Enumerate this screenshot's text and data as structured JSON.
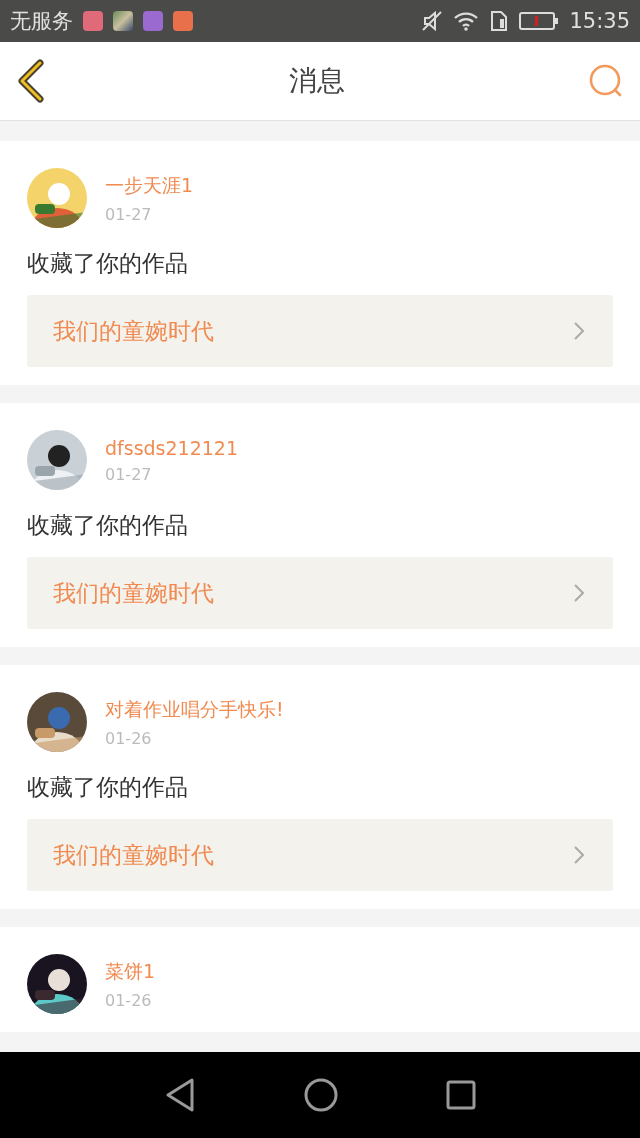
{
  "status_bar": {
    "carrier": "无服务",
    "time": "15:35"
  },
  "header": {
    "title": "消息"
  },
  "messages": [
    {
      "user": "一步天涯1",
      "date": "01-27",
      "action": "收藏了你的作品",
      "work": "我们的童婉时代"
    },
    {
      "user": "dfssds212121",
      "date": "01-27",
      "action": "收藏了你的作品",
      "work": "我们的童婉时代"
    },
    {
      "user": "对着作业唱分手快乐!",
      "date": "01-26",
      "action": "收藏了你的作品",
      "work": "我们的童婉时代"
    },
    {
      "user": "菜饼1",
      "date": "01-26"
    }
  ]
}
